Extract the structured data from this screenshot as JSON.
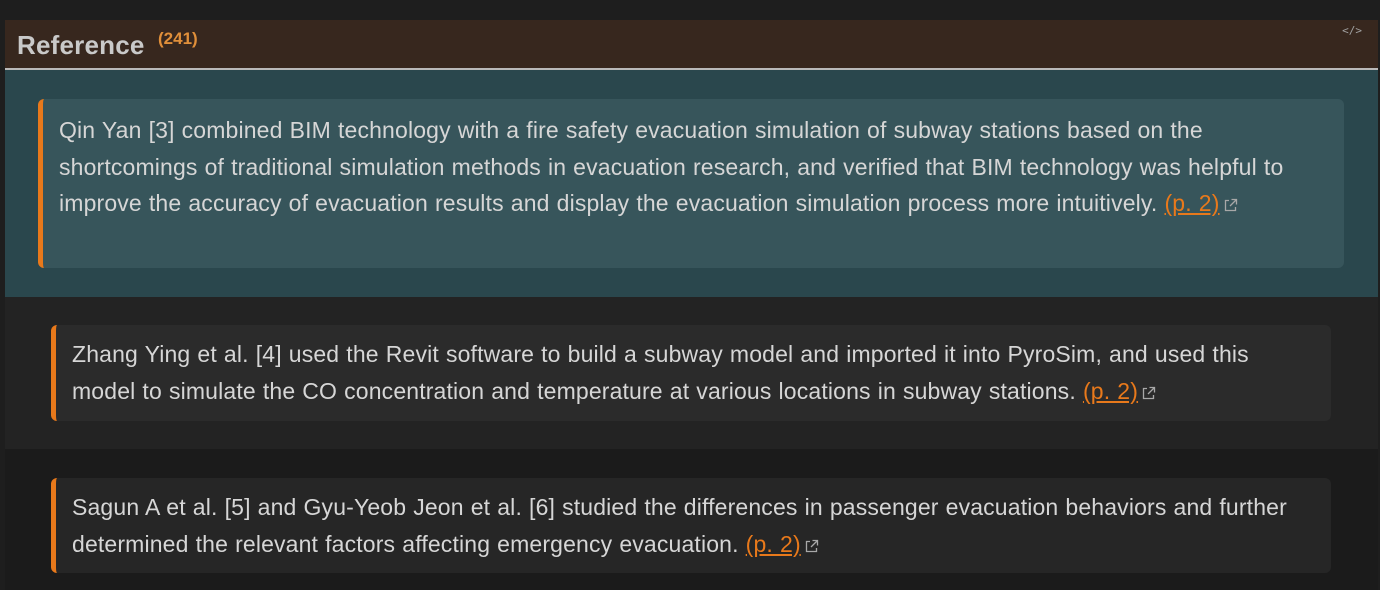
{
  "header": {
    "title": "Reference",
    "count": "(241)",
    "code_icon": "</>",
    "accent_color": "#e8791b",
    "header_bg": "#37271e"
  },
  "quotes": [
    {
      "text": "Qin Yan [3] combined BIM technology with a fire safety evacuation simulation of subway stations based on the shortcomings of traditional simulation methods in evacuation research, and verified that BIM technology was helpful to improve the accuracy of evacuation results and display the evacuation simulation process more intuitively.",
      "page_link": "(p. 2)",
      "icon": "external-link-icon"
    },
    {
      "text": "Zhang Ying et al. [4] used the Revit software to build a subway model and imported it into PyroSim, and used this model to simulate the CO concentration and temperature at various locations in subway stations.",
      "page_link": "(p. 2)",
      "icon": "external-link-icon"
    },
    {
      "text": "Sagun A et al. [5] and Gyu-Yeob Jeon et al. [6] studied the differences in passenger evacuation behaviors and further determined the relevant factors affecting emergency evacuation.",
      "page_link": "(p. 2)",
      "icon": "external-link-icon"
    }
  ]
}
